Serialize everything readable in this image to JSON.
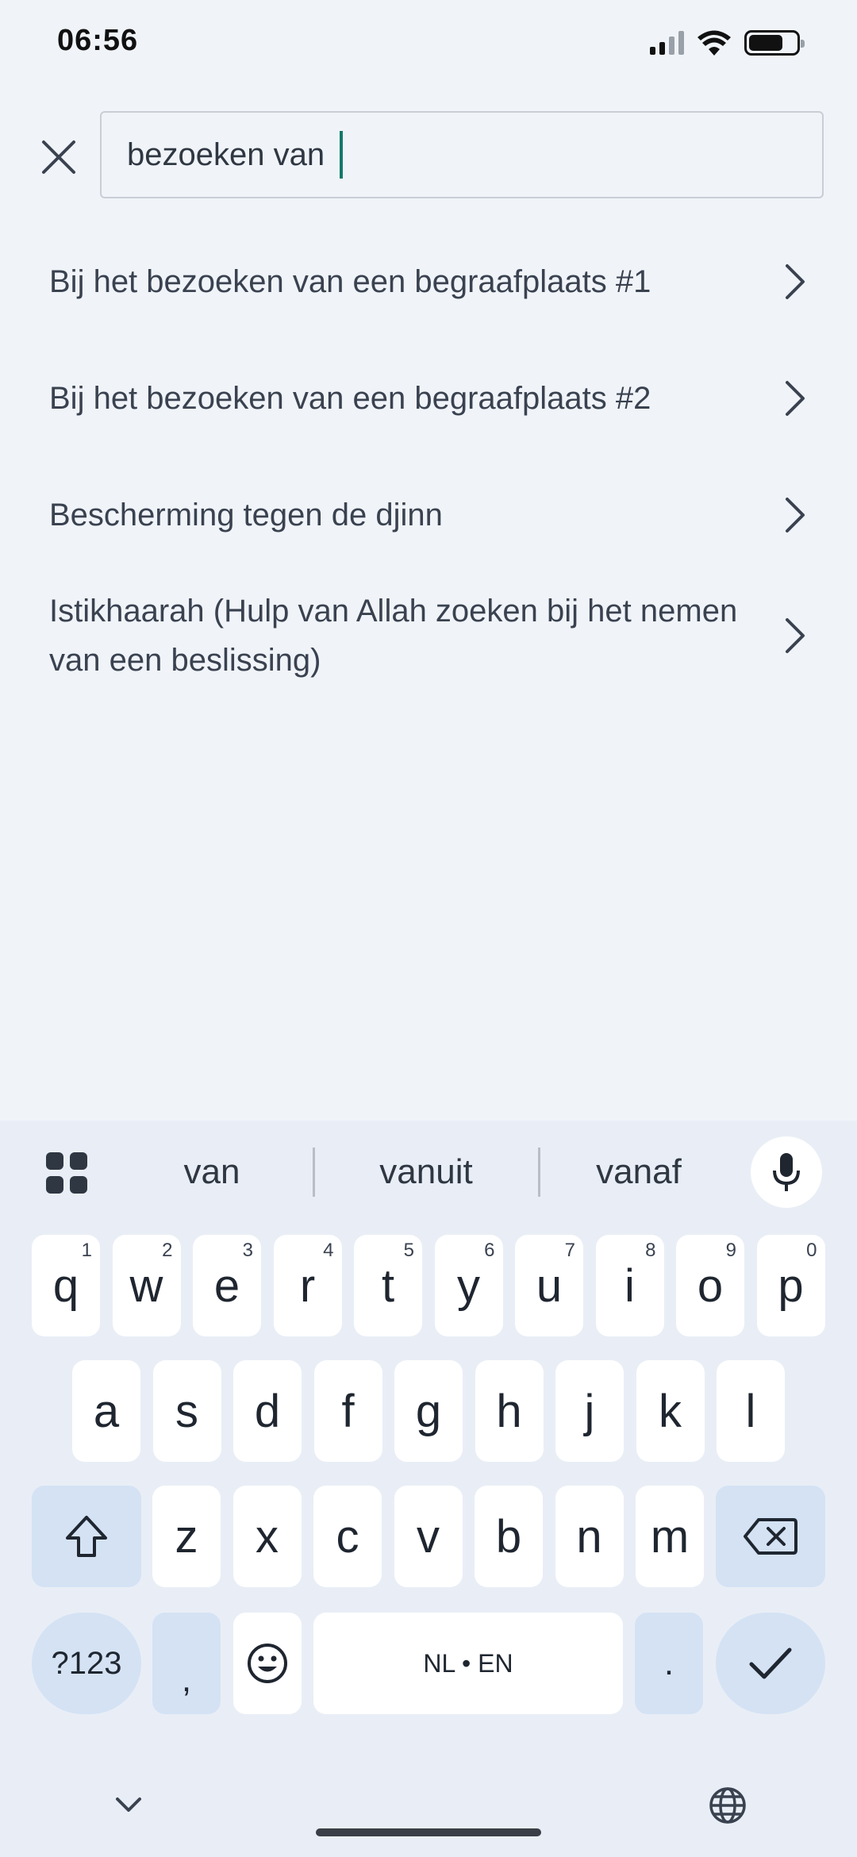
{
  "status_bar": {
    "time": "06:56"
  },
  "search": {
    "value": "bezoeken van"
  },
  "results": [
    {
      "label": "Bij het bezoeken van een begraafplaats #1"
    },
    {
      "label": "Bij het bezoeken van een begraafplaats #2"
    },
    {
      "label": "Bescherming tegen de djinn"
    },
    {
      "label": "Istikhaarah (Hulp van Allah zoeken bij het nemen van een beslissing)"
    }
  ],
  "keyboard": {
    "suggestions": [
      "van",
      "vanuit",
      "vanaf"
    ],
    "row1": [
      {
        "key": "q",
        "num": "1"
      },
      {
        "key": "w",
        "num": "2"
      },
      {
        "key": "e",
        "num": "3"
      },
      {
        "key": "r",
        "num": "4"
      },
      {
        "key": "t",
        "num": "5"
      },
      {
        "key": "y",
        "num": "6"
      },
      {
        "key": "u",
        "num": "7"
      },
      {
        "key": "i",
        "num": "8"
      },
      {
        "key": "o",
        "num": "9"
      },
      {
        "key": "p",
        "num": "0"
      }
    ],
    "row2": [
      "a",
      "s",
      "d",
      "f",
      "g",
      "h",
      "j",
      "k",
      "l"
    ],
    "row3": [
      "z",
      "x",
      "c",
      "v",
      "b",
      "n",
      "m"
    ],
    "symbols_label": "?123",
    "comma_label": ",",
    "space_label": "NL • EN",
    "period_label": "."
  },
  "icons": {
    "close": "close-icon",
    "chevron": "chevron-right-icon",
    "apps": "apps-grid-icon",
    "mic": "microphone-icon",
    "shift": "shift-icon",
    "backspace": "backspace-icon",
    "emoji": "emoji-icon",
    "enter": "checkmark-icon",
    "collapse": "chevron-down-icon",
    "language": "globe-icon"
  }
}
